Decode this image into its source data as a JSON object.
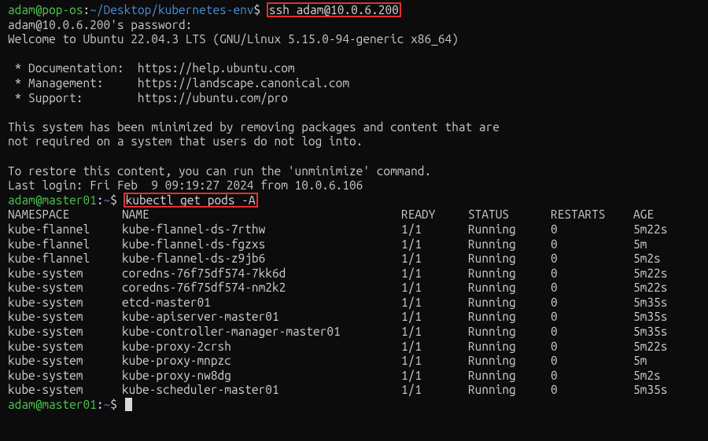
{
  "prompt1": {
    "user": "adam",
    "host": "pop-os",
    "sep": ":",
    "path": "~/Desktop/kubernetes-env",
    "sym": "$",
    "command": "ssh adam@10.0.6.200"
  },
  "ssh": {
    "pw_prompt": "adam@10.0.6.200's password:",
    "welcome": "Welcome to Ubuntu 22.04.3 LTS (GNU/Linux 5.15.0-94-generic x86_64)",
    "bullets": [
      " * Documentation:  https://help.ubuntu.com",
      " * Management:     https://landscape.canonical.com",
      " * Support:        https://ubuntu.com/pro"
    ],
    "minimized1": "This system has been minimized by removing packages and content that are",
    "minimized2": "not required on a system that users do not log into.",
    "restore": "To restore this content, you can run the 'unminimize' command.",
    "lastlogin": "Last login: Fri Feb  9 09:19:27 2024 from 10.0.6.106"
  },
  "prompt2": {
    "user": "adam",
    "host": "master01",
    "sep": ":",
    "path": "~",
    "sym": "$",
    "command": "kubectl get pods -A"
  },
  "table": {
    "headers": {
      "ns": "NAMESPACE",
      "name": "NAME",
      "ready": "READY",
      "status": "STATUS",
      "restarts": "RESTARTS",
      "age": "AGE"
    },
    "rows": [
      {
        "ns": "kube-flannel",
        "name": "kube-flannel-ds-7rthw",
        "ready": "1/1",
        "status": "Running",
        "restarts": "0",
        "age": "5m22s"
      },
      {
        "ns": "kube-flannel",
        "name": "kube-flannel-ds-fgzxs",
        "ready": "1/1",
        "status": "Running",
        "restarts": "0",
        "age": "5m"
      },
      {
        "ns": "kube-flannel",
        "name": "kube-flannel-ds-z9jb6",
        "ready": "1/1",
        "status": "Running",
        "restarts": "0",
        "age": "5m2s"
      },
      {
        "ns": "kube-system",
        "name": "coredns-76f75df574-7kk6d",
        "ready": "1/1",
        "status": "Running",
        "restarts": "0",
        "age": "5m22s"
      },
      {
        "ns": "kube-system",
        "name": "coredns-76f75df574-nm2k2",
        "ready": "1/1",
        "status": "Running",
        "restarts": "0",
        "age": "5m22s"
      },
      {
        "ns": "kube-system",
        "name": "etcd-master01",
        "ready": "1/1",
        "status": "Running",
        "restarts": "0",
        "age": "5m35s"
      },
      {
        "ns": "kube-system",
        "name": "kube-apiserver-master01",
        "ready": "1/1",
        "status": "Running",
        "restarts": "0",
        "age": "5m35s"
      },
      {
        "ns": "kube-system",
        "name": "kube-controller-manager-master01",
        "ready": "1/1",
        "status": "Running",
        "restarts": "0",
        "age": "5m35s"
      },
      {
        "ns": "kube-system",
        "name": "kube-proxy-2crsh",
        "ready": "1/1",
        "status": "Running",
        "restarts": "0",
        "age": "5m22s"
      },
      {
        "ns": "kube-system",
        "name": "kube-proxy-mnpzc",
        "ready": "1/1",
        "status": "Running",
        "restarts": "0",
        "age": "5m"
      },
      {
        "ns": "kube-system",
        "name": "kube-proxy-nw8dg",
        "ready": "1/1",
        "status": "Running",
        "restarts": "0",
        "age": "5m2s"
      },
      {
        "ns": "kube-system",
        "name": "kube-scheduler-master01",
        "ready": "1/1",
        "status": "Running",
        "restarts": "0",
        "age": "5m35s"
      }
    ]
  },
  "prompt3": {
    "user": "adam",
    "host": "master01",
    "sep": ":",
    "path": "~",
    "sym": "$"
  }
}
